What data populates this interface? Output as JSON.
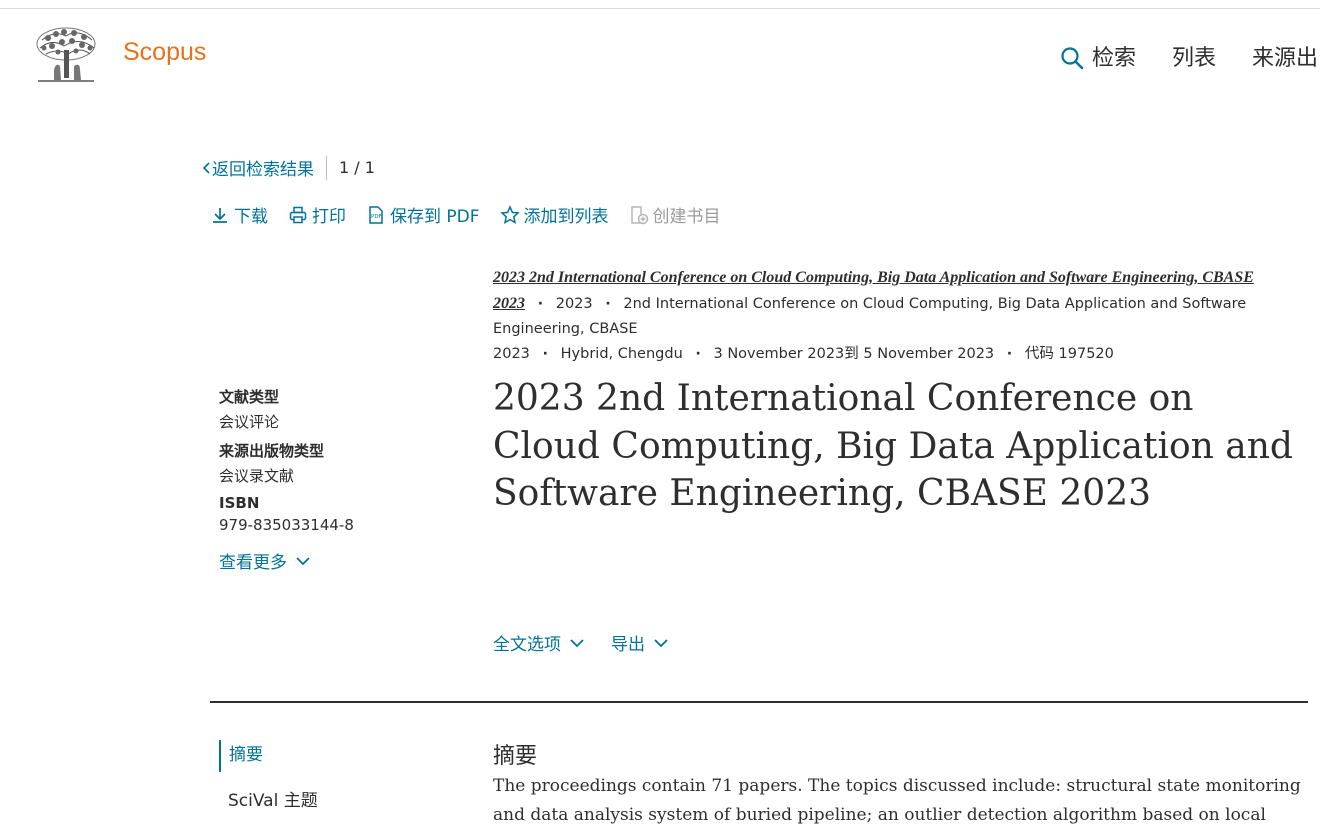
{
  "header": {
    "brand": "Scopus",
    "nav": {
      "search": "检索",
      "lists": "列表",
      "sources": "来源出"
    }
  },
  "navigation": {
    "back_label": "返回检索结果",
    "counter": "1 / 1"
  },
  "actions": {
    "download": "下载",
    "print": "打印",
    "save_pdf": "保存到 PDF",
    "add_to_list": "添加到列表",
    "create_bibliography": "创建书目"
  },
  "source": {
    "link_line1": "2023 2nd International Conference on Cloud Computing, Big Data Application and Software Engineering, CBASE",
    "link_line2": "2023",
    "year": "2023",
    "conference_part1": "2nd International Conference on Cloud Computing, Big Data Application and Software Engineering, CBASE",
    "conference_part2": "2023",
    "location": "Hybrid, Chengdu",
    "dates": "3 November 2023到 5 November 2023",
    "code": "代码 197520"
  },
  "metadata": {
    "doc_type_label": "文献类型",
    "doc_type_value": "会议评论",
    "source_type_label": "来源出版物类型",
    "source_type_value": "会议录文献",
    "isbn_label": "ISBN",
    "isbn_value": "979-835033144-8",
    "see_more": "查看更多"
  },
  "title": "2023 2nd International Conference on Cloud Computing, Big Data Application and Software Engineering, CBASE 2023",
  "options": {
    "full_text": "全文选项",
    "export": "导出"
  },
  "sidenav": {
    "abstract": "摘要",
    "scival": "SciVal 主题"
  },
  "abstract": {
    "heading": "摘要",
    "text": "The proceedings contain 71 papers. The topics discussed include: structural state monitoring and data analysis system of buried pipeline; an outlier detection algorithm based on local density and"
  },
  "colors": {
    "brand": "#e9711c",
    "link": "#007398",
    "text": "#2e2e2e"
  }
}
